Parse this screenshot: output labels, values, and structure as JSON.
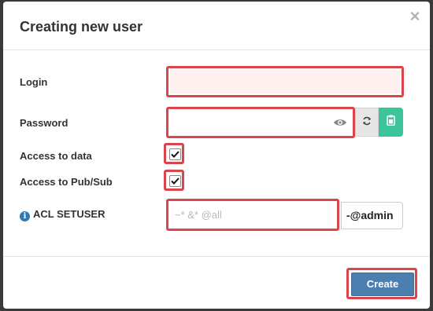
{
  "dialog": {
    "title": "Creating new user",
    "close_glyph": "×"
  },
  "form": {
    "login": {
      "label": "Login",
      "value": "",
      "placeholder": ""
    },
    "password": {
      "label": "Password",
      "value": "",
      "placeholder": "",
      "icon": "eye-icon"
    },
    "password_actions": [
      {
        "name": "refresh-password-button",
        "icon": "refresh-icon",
        "color": "#e6e6e6"
      },
      {
        "name": "copy-password-button",
        "icon": "clipboard-icon",
        "color": "#3ec49a"
      }
    ],
    "access_data": {
      "label": "Access to data",
      "checked": true
    },
    "access_pubsub": {
      "label": "Access to Pub/Sub",
      "checked": true
    },
    "acl": {
      "label": "ACL SETUSER",
      "info_icon": "info-icon",
      "value": "",
      "placeholder": "~* &* @all",
      "addon": "-@admin"
    }
  },
  "footer": {
    "create_label": "Create"
  },
  "colors": {
    "highlight": "#d9444d",
    "primary": "#4a7fb0",
    "success": "#3ec49a",
    "login_bg": "#fff0f0"
  }
}
